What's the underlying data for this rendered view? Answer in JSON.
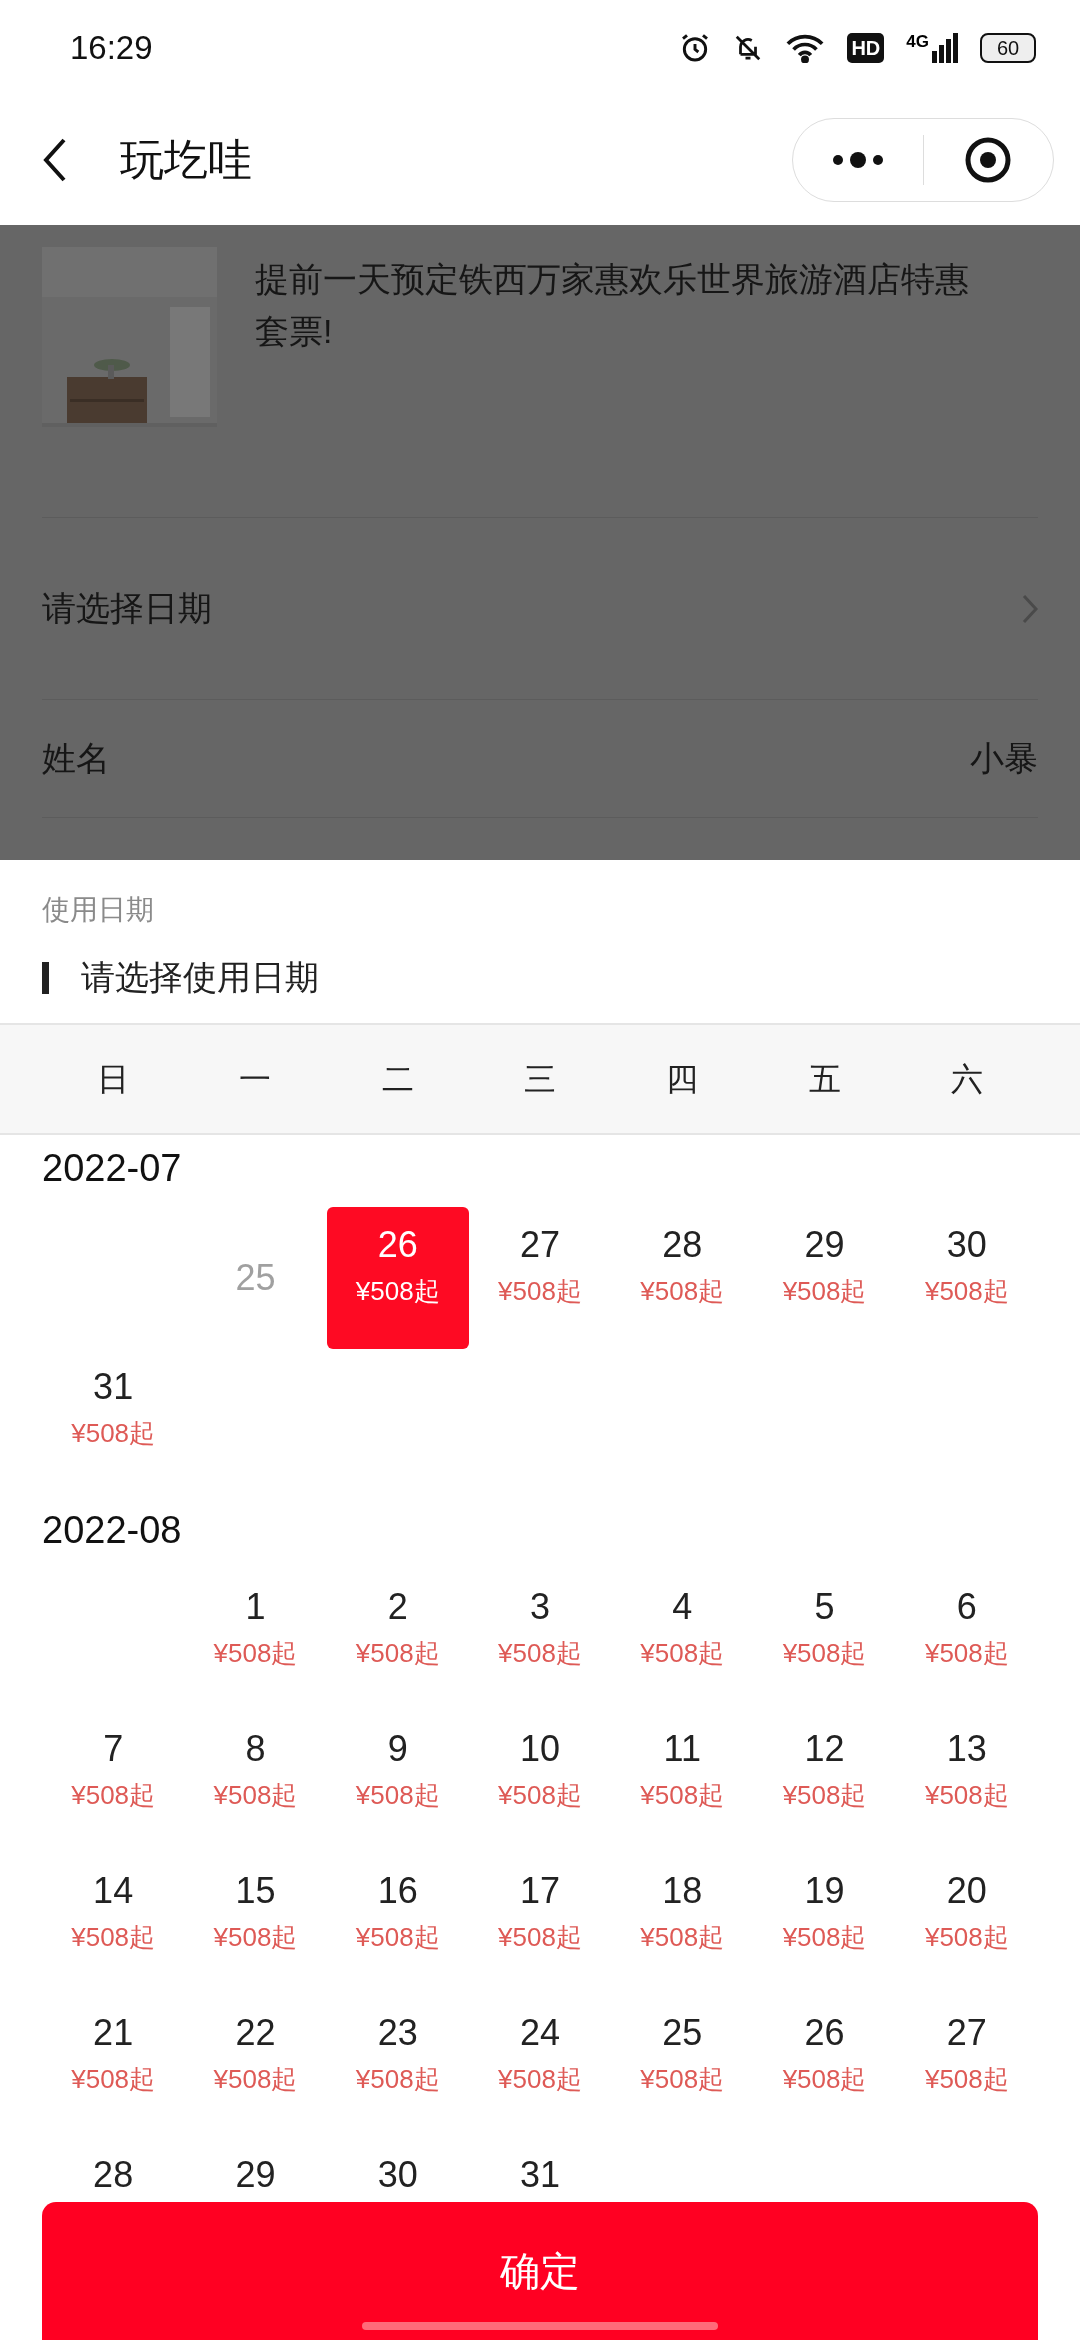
{
  "status_bar": {
    "time": "16:29",
    "network_badge": "HD",
    "network_type": "4G",
    "battery": "60"
  },
  "nav": {
    "title": "玩圪哇"
  },
  "product": {
    "title": "提前一天预定铁西万家惠欢乐世界旅游酒店特惠套票!"
  },
  "form": [
    {
      "kind": "link",
      "label": "请选择日期"
    },
    {
      "kind": "value",
      "label": "姓名",
      "value": "小暴"
    }
  ],
  "sheet": {
    "title": "使用日期",
    "subtitle": "请选择使用日期"
  },
  "weekdays": [
    "日",
    "一",
    "二",
    "三",
    "四",
    "五",
    "六"
  ],
  "months": [
    {
      "title": "2022-07",
      "days": [
        {
          "kind": "blank"
        },
        {
          "kind": "day",
          "day": "25",
          "disabled": true,
          "selected": false
        },
        {
          "kind": "day",
          "day": "26",
          "price": "¥508起",
          "disabled": false,
          "selected": true
        },
        {
          "kind": "day",
          "day": "27",
          "price": "¥508起",
          "disabled": false,
          "selected": false
        },
        {
          "kind": "day",
          "day": "28",
          "price": "¥508起",
          "disabled": false,
          "selected": false
        },
        {
          "kind": "day",
          "day": "29",
          "price": "¥508起",
          "disabled": false,
          "selected": false
        },
        {
          "kind": "day",
          "day": "30",
          "price": "¥508起",
          "disabled": false,
          "selected": false
        },
        {
          "kind": "day",
          "day": "31",
          "price": "¥508起",
          "disabled": false,
          "selected": false
        }
      ]
    },
    {
      "title": "2022-08",
      "days": [
        {
          "kind": "blank"
        },
        {
          "kind": "day",
          "day": "1",
          "price": "¥508起",
          "disabled": false,
          "selected": false
        },
        {
          "kind": "day",
          "day": "2",
          "price": "¥508起",
          "disabled": false,
          "selected": false
        },
        {
          "kind": "day",
          "day": "3",
          "price": "¥508起",
          "disabled": false,
          "selected": false
        },
        {
          "kind": "day",
          "day": "4",
          "price": "¥508起",
          "disabled": false,
          "selected": false
        },
        {
          "kind": "day",
          "day": "5",
          "price": "¥508起",
          "disabled": false,
          "selected": false
        },
        {
          "kind": "day",
          "day": "6",
          "price": "¥508起",
          "disabled": false,
          "selected": false
        },
        {
          "kind": "day",
          "day": "7",
          "price": "¥508起",
          "disabled": false,
          "selected": false
        },
        {
          "kind": "day",
          "day": "8",
          "price": "¥508起",
          "disabled": false,
          "selected": false
        },
        {
          "kind": "day",
          "day": "9",
          "price": "¥508起",
          "disabled": false,
          "selected": false
        },
        {
          "kind": "day",
          "day": "10",
          "price": "¥508起",
          "disabled": false,
          "selected": false
        },
        {
          "kind": "day",
          "day": "11",
          "price": "¥508起",
          "disabled": false,
          "selected": false
        },
        {
          "kind": "day",
          "day": "12",
          "price": "¥508起",
          "disabled": false,
          "selected": false
        },
        {
          "kind": "day",
          "day": "13",
          "price": "¥508起",
          "disabled": false,
          "selected": false
        },
        {
          "kind": "day",
          "day": "14",
          "price": "¥508起",
          "disabled": false,
          "selected": false
        },
        {
          "kind": "day",
          "day": "15",
          "price": "¥508起",
          "disabled": false,
          "selected": false
        },
        {
          "kind": "day",
          "day": "16",
          "price": "¥508起",
          "disabled": false,
          "selected": false
        },
        {
          "kind": "day",
          "day": "17",
          "price": "¥508起",
          "disabled": false,
          "selected": false
        },
        {
          "kind": "day",
          "day": "18",
          "price": "¥508起",
          "disabled": false,
          "selected": false
        },
        {
          "kind": "day",
          "day": "19",
          "price": "¥508起",
          "disabled": false,
          "selected": false
        },
        {
          "kind": "day",
          "day": "20",
          "price": "¥508起",
          "disabled": false,
          "selected": false
        },
        {
          "kind": "day",
          "day": "21",
          "price": "¥508起",
          "disabled": false,
          "selected": false
        },
        {
          "kind": "day",
          "day": "22",
          "price": "¥508起",
          "disabled": false,
          "selected": false
        },
        {
          "kind": "day",
          "day": "23",
          "price": "¥508起",
          "disabled": false,
          "selected": false
        },
        {
          "kind": "day",
          "day": "24",
          "price": "¥508起",
          "disabled": false,
          "selected": false
        },
        {
          "kind": "day",
          "day": "25",
          "price": "¥508起",
          "disabled": false,
          "selected": false
        },
        {
          "kind": "day",
          "day": "26",
          "price": "¥508起",
          "disabled": false,
          "selected": false
        },
        {
          "kind": "day",
          "day": "27",
          "price": "¥508起",
          "disabled": false,
          "selected": false
        },
        {
          "kind": "day",
          "day": "28",
          "disabled": false,
          "selected": false
        },
        {
          "kind": "day",
          "day": "29",
          "disabled": false,
          "selected": false
        },
        {
          "kind": "day",
          "day": "30",
          "disabled": false,
          "selected": false
        },
        {
          "kind": "day",
          "day": "31",
          "disabled": false,
          "selected": false
        }
      ]
    }
  ],
  "confirm_button": "确定"
}
